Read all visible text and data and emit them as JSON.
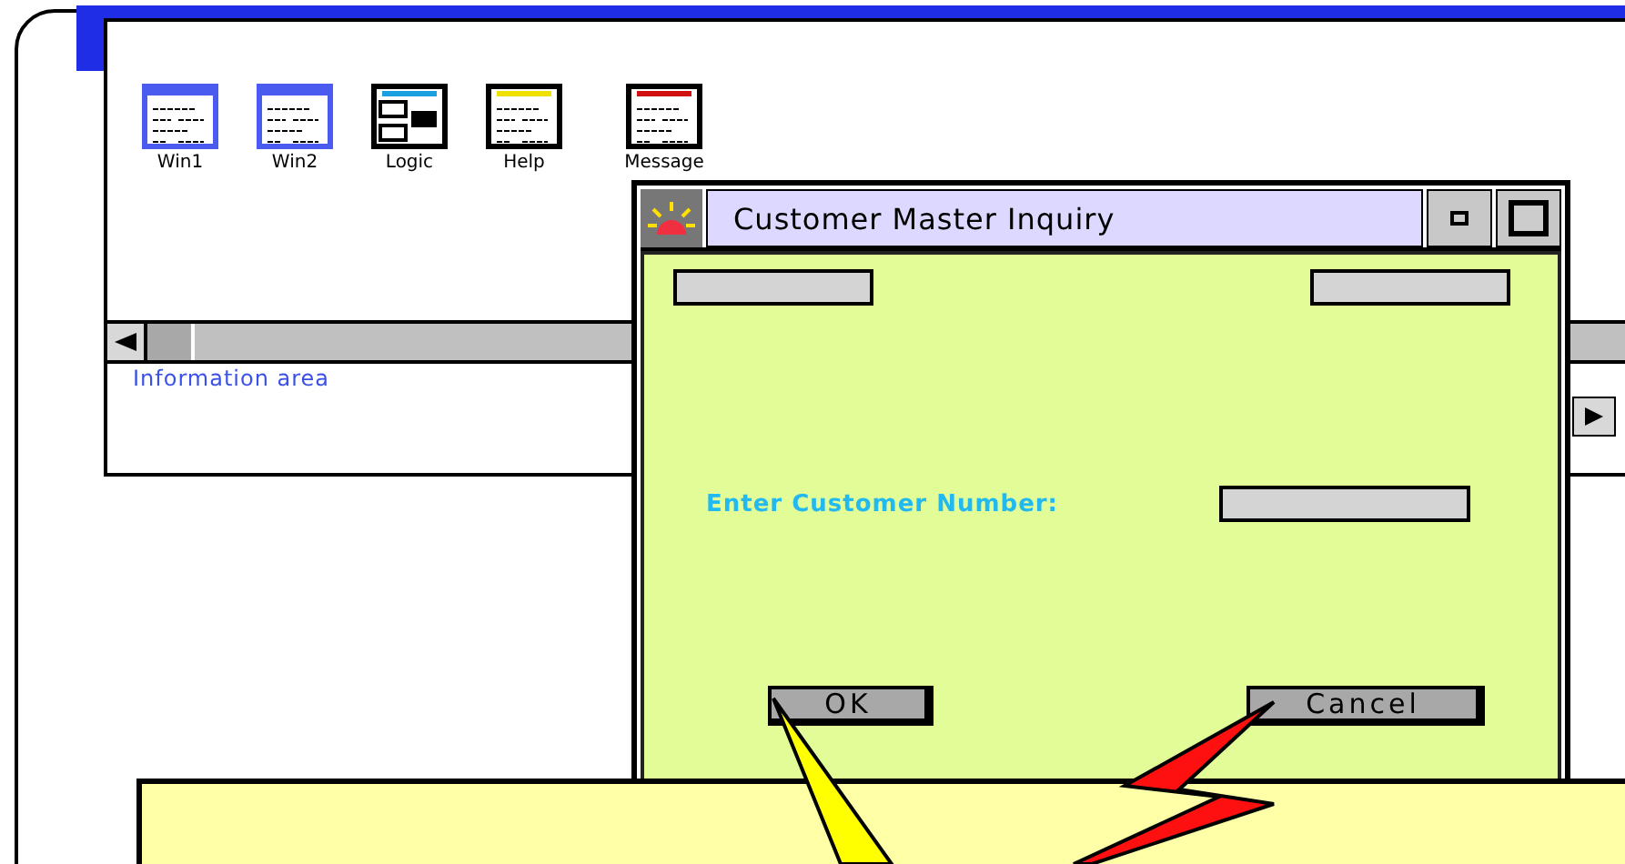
{
  "background_window": {
    "icons": [
      {
        "label": "Win1",
        "kind": "window",
        "color": "#4a5cf0"
      },
      {
        "label": "Win2",
        "kind": "window",
        "color": "#4a5cf0"
      },
      {
        "label": "Logic",
        "kind": "logic",
        "color": "#1aa0e0"
      },
      {
        "label": "Help",
        "kind": "document",
        "color": "#f0e000"
      },
      {
        "label": "Message",
        "kind": "document",
        "color": "#d01010"
      }
    ],
    "status": "Information area"
  },
  "dialog": {
    "title": "Customer Master Inquiry",
    "prompt": "Enter Customer Number:",
    "buttons": [
      "OK",
      "Cancel"
    ]
  }
}
